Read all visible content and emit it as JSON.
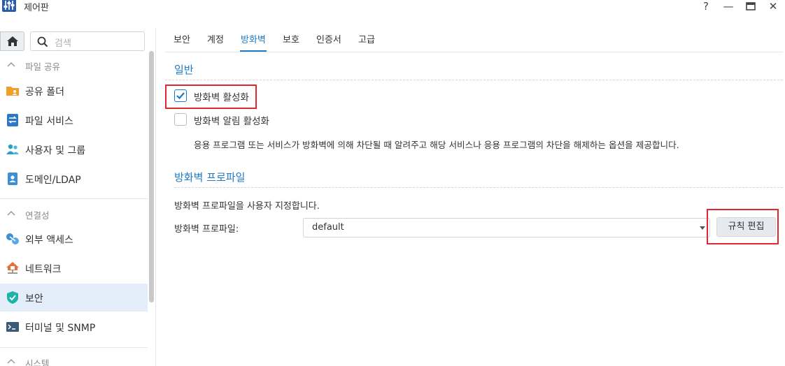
{
  "window": {
    "title": "제어판",
    "help_icon": "?",
    "minimize_icon": "—",
    "maximize_icon": "▭",
    "close_icon": "✕"
  },
  "sidebar": {
    "search_placeholder": "검색",
    "categories": {
      "file_sharing": "파일 공유",
      "connectivity": "연결성",
      "system": "시스템"
    },
    "items": [
      {
        "label": "공유 폴더",
        "icon": "shared-folder-icon"
      },
      {
        "label": "파일 서비스",
        "icon": "file-services-icon"
      },
      {
        "label": "사용자 및 그룹",
        "icon": "users-groups-icon"
      },
      {
        "label": "도메인/LDAP",
        "icon": "domain-ldap-icon"
      },
      {
        "label": "외부 액세스",
        "icon": "external-access-icon"
      },
      {
        "label": "네트워크",
        "icon": "network-icon"
      },
      {
        "label": "보안",
        "icon": "security-shield-icon",
        "active": true
      },
      {
        "label": "터미널 및 SNMP",
        "icon": "terminal-icon"
      }
    ]
  },
  "tabs": [
    {
      "label": "보안"
    },
    {
      "label": "계정"
    },
    {
      "label": "방화벽",
      "active": true
    },
    {
      "label": "보호"
    },
    {
      "label": "인증서"
    },
    {
      "label": "고급"
    }
  ],
  "general": {
    "title": "일반",
    "enable_firewall": {
      "label": "방화벽 활성화",
      "checked": true
    },
    "enable_notifications": {
      "label": "방화벽 알림 활성화",
      "checked": false
    },
    "notification_desc": "응용 프로그램 또는 서비스가 방화벽에 의해 차단될 때 알려주고 해당 서비스나 응용 프로그램의 차단을 해제하는 옵션을 제공합니다."
  },
  "profile": {
    "title": "방화벽 프로파일",
    "desc": "방화벽 프로파일을 사용자 지정합니다.",
    "field_label": "방화벽 프로파일:",
    "selected": "default",
    "edit_rules_label": "규칙 편집"
  },
  "colors": {
    "accent": "#1e7ac6",
    "highlight_box": "#e0282e",
    "active_nav_bg": "#e3eefa"
  }
}
